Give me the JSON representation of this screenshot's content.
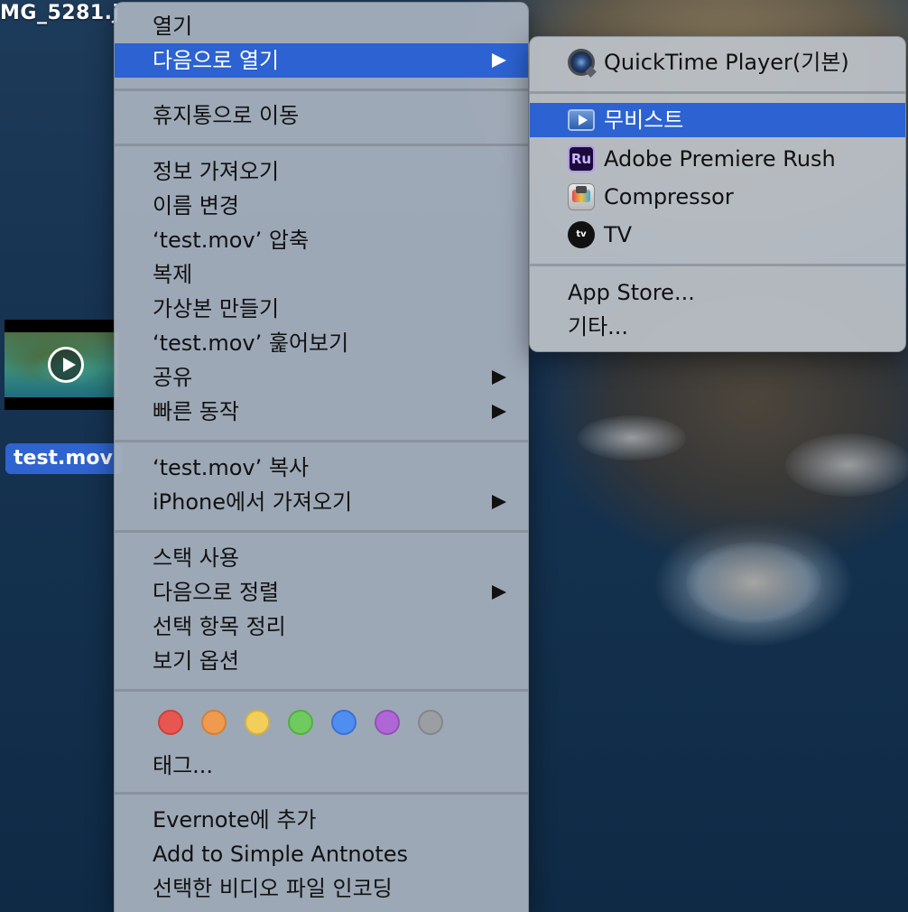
{
  "desktop": {
    "top_file_label": "MG_5281.j",
    "selected_file_label": "test.mov"
  },
  "context_menu": {
    "items": [
      {
        "label": "열기"
      },
      {
        "label": "다음으로 열기",
        "has_submenu": true,
        "selected": true
      },
      {
        "label": "휴지통으로 이동"
      },
      {
        "label": "정보 가져오기"
      },
      {
        "label": "이름 변경"
      },
      {
        "label": "‘test.mov’ 압축"
      },
      {
        "label": "복제"
      },
      {
        "label": "가상본 만들기"
      },
      {
        "label": "‘test.mov’ 훑어보기"
      },
      {
        "label": "공유",
        "has_submenu": true
      },
      {
        "label": "빠른 동작",
        "has_submenu": true
      },
      {
        "label": "‘test.mov’ 복사"
      },
      {
        "label": "iPhone에서 가져오기",
        "has_submenu": true
      },
      {
        "label": "스택 사용"
      },
      {
        "label": "다음으로 정렬",
        "has_submenu": true
      },
      {
        "label": "선택 항목 정리"
      },
      {
        "label": "보기 옵션"
      },
      {
        "label": "태그..."
      },
      {
        "label": "Evernote에 추가"
      },
      {
        "label": "Add to Simple Antnotes"
      },
      {
        "label": "선택한 비디오 파일 인코딩"
      }
    ],
    "tag_colors": [
      {
        "name": "red",
        "fill": "#e8574f",
        "stroke": "#c9433c"
      },
      {
        "name": "orange",
        "fill": "#ef9a4e",
        "stroke": "#d2803a"
      },
      {
        "name": "yellow",
        "fill": "#f2cf5a",
        "stroke": "#d4b144"
      },
      {
        "name": "green",
        "fill": "#6fcb5d",
        "stroke": "#55ad45"
      },
      {
        "name": "blue",
        "fill": "#4f8df0",
        "stroke": "#3a72d2"
      },
      {
        "name": "purple",
        "fill": "#b067d6",
        "stroke": "#944fb8"
      },
      {
        "name": "gray",
        "fill": "#9b9ea3",
        "stroke": "#83868b"
      }
    ]
  },
  "open_with_submenu": {
    "default_app": {
      "label": "QuickTime Player(기본)",
      "icon": "quicktime-icon"
    },
    "apps": [
      {
        "label": "무비스트",
        "icon": "movist-icon",
        "selected": true
      },
      {
        "label": "Adobe Premiere Rush",
        "icon": "premiere-rush-icon",
        "icon_text": "Ru"
      },
      {
        "label": "Compressor",
        "icon": "compressor-icon"
      },
      {
        "label": "TV",
        "icon": "apple-tv-icon",
        "icon_text": "tv"
      }
    ],
    "app_store_label": "App Store...",
    "other_label": "기타..."
  },
  "colors": {
    "selection_blue": "#2c62d1",
    "menu_background": "#a8b2be"
  }
}
